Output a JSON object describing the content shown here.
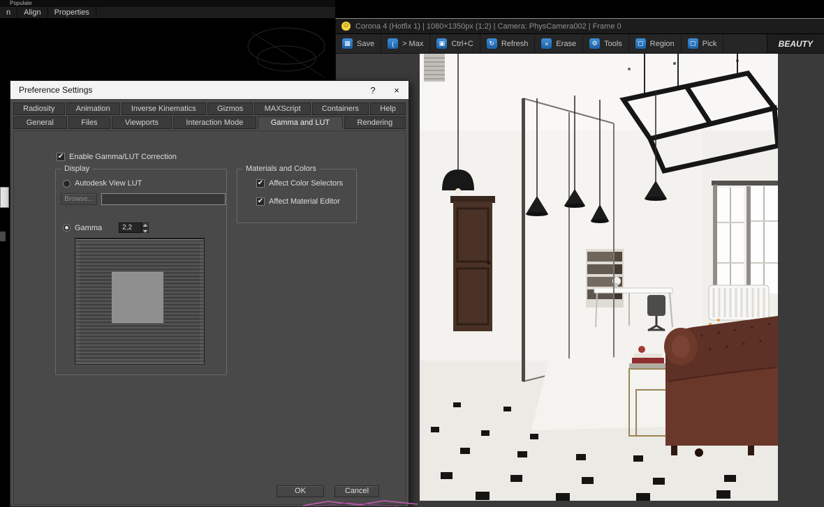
{
  "menubar": {
    "row1": "Populate",
    "items": [
      "n",
      "Align",
      "Properties"
    ]
  },
  "corona": {
    "smiley_icon": "☺",
    "title": "Corona 4 (Hotfix 1) | 1080×1350px (1:2) | Camera: PhysCamera002 | Frame 0",
    "toolbar": [
      {
        "icon": "▦",
        "label": "Save"
      },
      {
        "icon": "(",
        "label": "> Max"
      },
      {
        "icon": "▣",
        "label": "Ctrl+C"
      },
      {
        "icon": "↻",
        "label": "Refresh"
      },
      {
        "icon": "×",
        "label": "Erase"
      },
      {
        "icon": "⚙",
        "label": "Tools"
      },
      {
        "icon": "▢",
        "label": "Region"
      },
      {
        "icon": "▢",
        "label": "Pick"
      }
    ],
    "render_mode": "BEAUTY"
  },
  "dialog": {
    "title": "Preference Settings",
    "help_label": "?",
    "close_label": "×",
    "tabs_row1": [
      {
        "label": "Radiosity"
      },
      {
        "label": "Animation"
      },
      {
        "label": "Inverse Kinematics"
      },
      {
        "label": "Gizmos"
      },
      {
        "label": "MAXScript"
      },
      {
        "label": "Containers"
      },
      {
        "label": "Help"
      }
    ],
    "tabs_row2": [
      {
        "label": "General"
      },
      {
        "label": "Files"
      },
      {
        "label": "Viewports"
      },
      {
        "label": "Interaction Mode"
      },
      {
        "label": "Gamma and LUT",
        "active": true
      },
      {
        "label": "Rendering"
      }
    ],
    "enable_gamma_label": "Enable Gamma/LUT Correction",
    "enable_gamma_checked": "✔",
    "display": {
      "group_label": "Display",
      "autodesk_lut_label": "Autodesk View LUT",
      "browse_label": "Browse...",
      "lut_path": "",
      "gamma_label": "Gamma",
      "gamma_value": "2,2"
    },
    "materials": {
      "group_label": "Materials and Colors",
      "affect_color_label": "Affect Color Selectors",
      "affect_color_checked": "✔",
      "affect_material_label": "Affect Material Editor",
      "affect_material_checked": "✔"
    },
    "ok_label": "OK",
    "cancel_label": "Cancel"
  },
  "colors": {
    "accent_blue": "#2f7fd0",
    "smiley_yellow": "#f5d33c",
    "dialog_bg": "#4b4b4b",
    "title_bar": "#f3f3f3"
  }
}
